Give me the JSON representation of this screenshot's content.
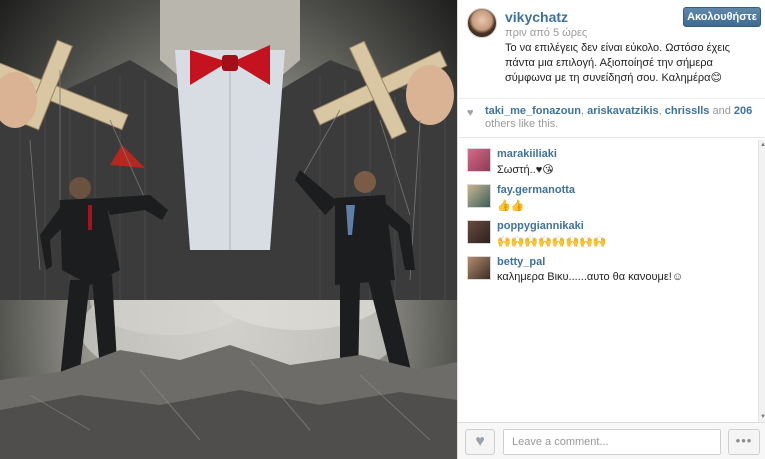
{
  "post": {
    "username": "vikychatz",
    "time": "πριν από 5 ώρες",
    "follow_label": "Ακολουθήστε",
    "caption": "Το να επιλέγεις δεν είναι εύκολο. Ωστόσο έχεις πάντα μια επιλογή. Αξιοποίησέ την σήμερα σύμφωνα με τη συνείδησή σου. Καλημέρα😊"
  },
  "likes": {
    "user1": "taki_me_fonazoun",
    "sep1": ", ",
    "user2": "ariskavatzikis",
    "sep2": ", ",
    "user3": "chrisslls",
    "and": " and ",
    "count": "206",
    "suffix": " others like this."
  },
  "comments": [
    {
      "username": "marakiiliaki",
      "text": "Σωστή..♥😘"
    },
    {
      "username": "fay.germanotta",
      "text": "👍👍"
    },
    {
      "username": "poppygiannikaki",
      "text": "🙌🙌🙌🙌🙌🙌🙌🙌"
    },
    {
      "username": "betty_pal",
      "text": "καλημερα Βικυ......αυτο θα κανουμε!☺"
    }
  ],
  "footer": {
    "comment_placeholder": "Leave a comment...",
    "more_label": "•••"
  },
  "icons": {
    "heart": "heart-icon",
    "more": "more-options-icon"
  },
  "colors": {
    "username": "#3f729b",
    "follow_button": "#4f7ba1"
  }
}
